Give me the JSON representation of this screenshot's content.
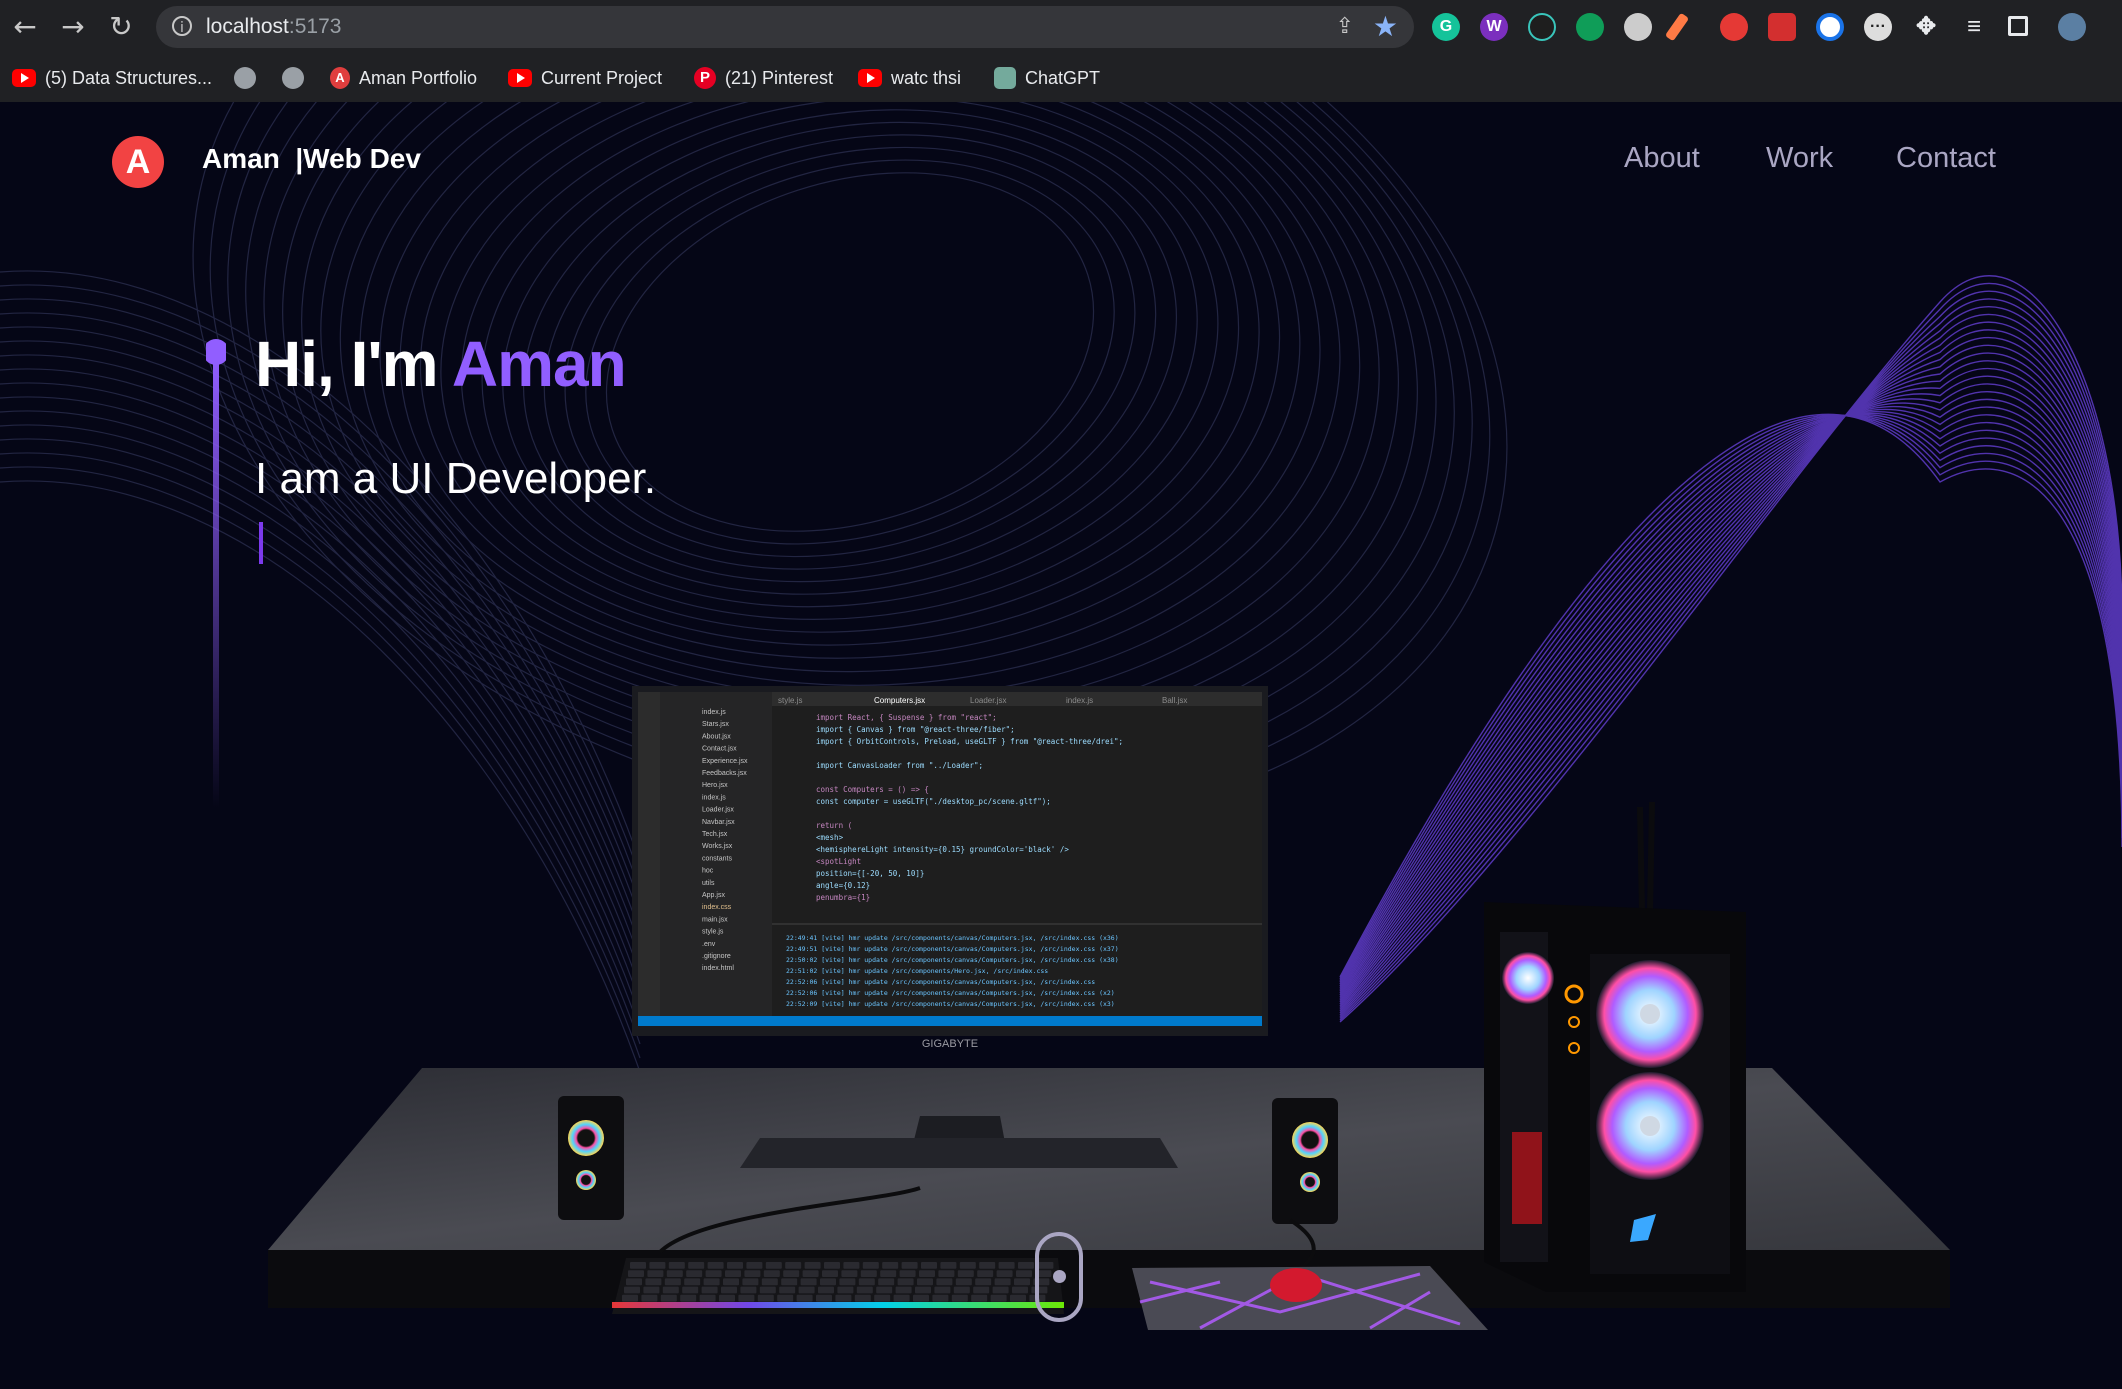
{
  "browser": {
    "url_host": "localhost",
    "url_port": ":5173",
    "bookmarks": [
      {
        "label": "(5) Data Structures...",
        "icon": "youtube-icon"
      },
      {
        "label": "",
        "icon": "globe-icon"
      },
      {
        "label": "",
        "icon": "globe-icon"
      },
      {
        "label": "Aman Portfolio",
        "icon": "aman-logo-icon"
      },
      {
        "label": "Current Project",
        "icon": "youtube-icon"
      },
      {
        "label": "(21) Pinterest",
        "icon": "pinterest-icon"
      },
      {
        "label": "watc thsi",
        "icon": "youtube-icon"
      },
      {
        "label": "ChatGPT",
        "icon": "chatgpt-icon"
      }
    ]
  },
  "site": {
    "brand_name": "Aman  |Web Dev",
    "nav": [
      "About",
      "Work",
      "Contact"
    ],
    "hero_greeting": "Hi, I'm ",
    "hero_name": "Aman",
    "hero_subtitle": "I am a UI Developer.",
    "accent_color": "#915eff",
    "logo_color": "#f24343"
  },
  "editor": {
    "tabs": [
      "style.js",
      "Computers.jsx",
      "Loader.jsx",
      "index.js",
      "Ball.jsx"
    ],
    "files": [
      "index.js",
      "Stars.jsx",
      "About.jsx",
      "Contact.jsx",
      "Experience.jsx",
      "Feedbacks.jsx",
      "Hero.jsx",
      "index.js",
      "Loader.jsx",
      "Navbar.jsx",
      "Tech.jsx",
      "Works.jsx",
      "constants",
      "hoc",
      "utils",
      "App.jsx",
      "index.css",
      "main.jsx",
      "style.js",
      ".env",
      ".gitignore",
      "index.html"
    ],
    "code": [
      "import React, { Suspense } from \"react\";",
      "import { Canvas } from \"@react-three/fiber\";",
      "import { OrbitControls, Preload, useGLTF } from \"@react-three/drei\";",
      "",
      "import CanvasLoader from \"../Loader\";",
      "",
      "const Computers = () => {",
      "  const computer = useGLTF(\"./desktop_pc/scene.gltf\");",
      "",
      "  return (",
      "    <mesh>",
      "      <hemisphereLight intensity={0.15} groundColor='black' />",
      "      <spotLight",
      "        position={[-20, 50, 10]}",
      "        angle={0.12}",
      "        penumbra={1}"
    ],
    "terminal": [
      "22:49:41 [vite] hmr update /src/components/canvas/Computers.jsx, /src/index.css (x36)",
      "22:49:51 [vite] hmr update /src/components/canvas/Computers.jsx, /src/index.css (x37)",
      "22:50:02 [vite] hmr update /src/components/canvas/Computers.jsx, /src/index.css (x38)",
      "22:51:02 [vite] hmr update /src/components/Hero.jsx, /src/index.css",
      "22:52:06 [vite] hmr update /src/components/canvas/Computers.jsx, /src/index.css",
      "22:52:06 [vite] hmr update /src/components/canvas/Computers.jsx, /src/index.css (x2)",
      "22:52:09 [vite] hmr update /src/components/canvas/Computers.jsx, /src/index.css (x3)"
    ],
    "monitor_brand": "GIGABYTE"
  }
}
